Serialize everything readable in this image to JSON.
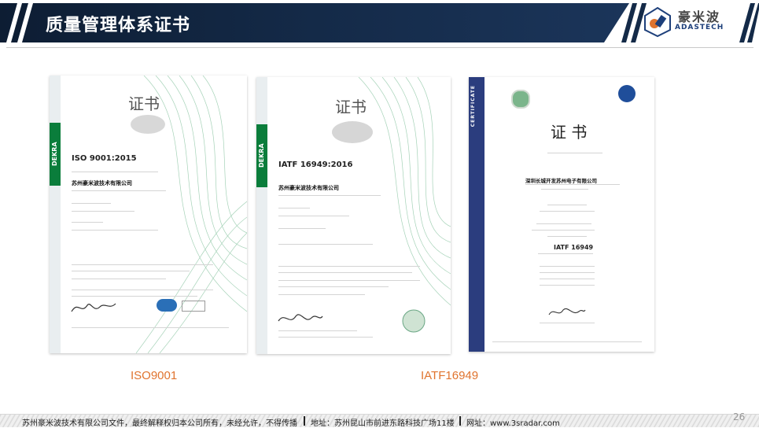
{
  "header": {
    "title": "质量管理体系证书",
    "logo_cn": "豪米波",
    "logo_en": "ADASTECH"
  },
  "certificates": [
    {
      "title": "证书",
      "standard": "ISO 9001:2015",
      "company": "苏州豪米波技术有限公司",
      "brand": "DEKRA",
      "caption": "ISO9001"
    },
    {
      "title": "证书",
      "standard": "IATF 16949:2016",
      "company": "苏州豪米波技术有限公司",
      "brand": "DEKRA",
      "caption": "IATF16949"
    },
    {
      "title": "证 书",
      "standard": "IATF 16949",
      "company": "深圳长城开发苏州电子有限公司",
      "brand": "CERTIFICATE"
    }
  ],
  "footer": {
    "copyright": "苏州豪米波技术有限公司文件，最终解释权归本公司所有，未经允许，不得传播",
    "address": "地址：苏州昆山市前进东路科技广场11楼",
    "website": "网址：www.3sradar.com",
    "page": "26"
  },
  "colors": {
    "header_dark": "#142a48",
    "caption": "#e0742f",
    "dekra_green": "#0a7d3b",
    "tuv_blue": "#2b3d7e"
  }
}
